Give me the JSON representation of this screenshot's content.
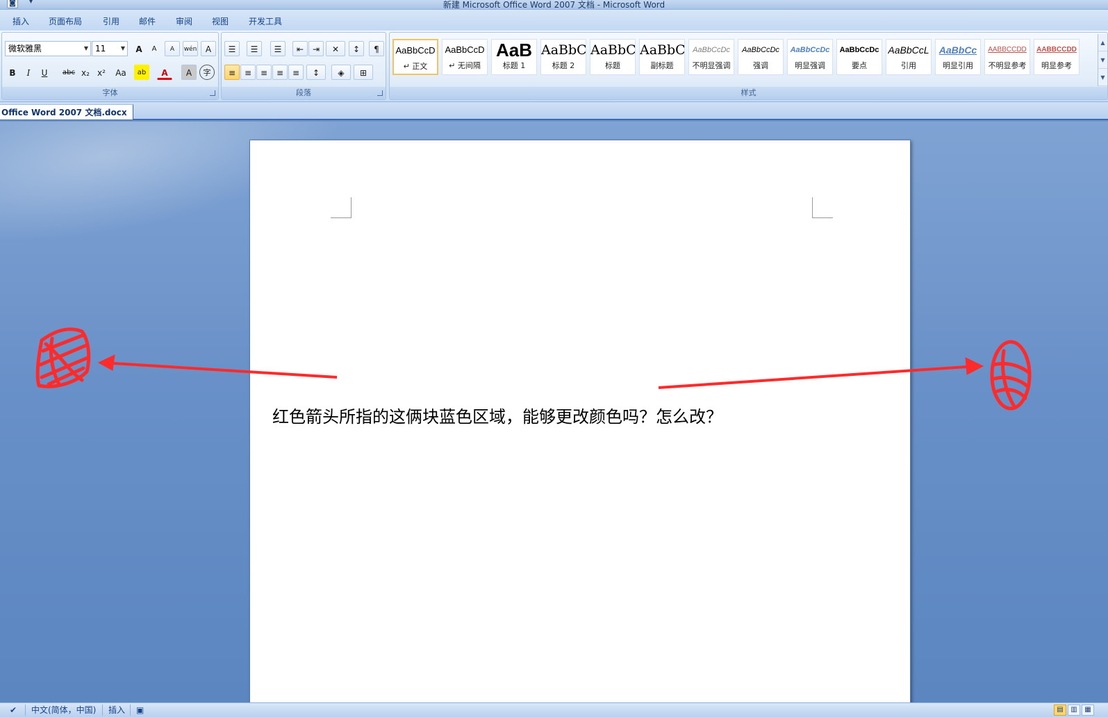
{
  "window": {
    "title": "新建 Microsoft Office Word 2007 文档 - Microsoft Word",
    "office_button_icon": "office-icon",
    "qat_dropdown": "▾"
  },
  "tabs": [
    "插入",
    "页面布局",
    "引用",
    "邮件",
    "审阅",
    "视图",
    "开发工具"
  ],
  "ribbon": {
    "font_group": {
      "label": "字体",
      "font_name": "微软雅黑",
      "font_size": "11",
      "grow_font": "A",
      "shrink_font": "A",
      "clear_format": "A",
      "phonetic_guide": "wén",
      "char_border": "A",
      "bold": "B",
      "italic": "I",
      "underline": "U",
      "strikethrough": "abc",
      "subscript": "x₂",
      "superscript": "x²",
      "change_case": "Aa",
      "highlight": "ab",
      "font_color": "A",
      "char_shading": "A",
      "enclose_char": "字"
    },
    "paragraph_group": {
      "label": "段落"
    },
    "styles_group": {
      "label": "样式",
      "styles": [
        {
          "preview": "AaBbCcD",
          "name": "↵ 正文"
        },
        {
          "preview": "AaBbCcD",
          "name": "↵ 无间隔"
        },
        {
          "preview": "AaB",
          "name": "标题 1"
        },
        {
          "preview": "AaBbC",
          "name": "标题 2"
        },
        {
          "preview": "AaBbC",
          "name": "标题"
        },
        {
          "preview": "AaBbC",
          "name": "副标题"
        },
        {
          "preview": "AaBbCcDc",
          "name": "不明显强调"
        },
        {
          "preview": "AaBbCcDc",
          "name": "强调"
        },
        {
          "preview": "AaBbCcDc",
          "name": "明显强调"
        },
        {
          "preview": "AaBbCcDc",
          "name": "要点"
        },
        {
          "preview": "AaBbCcL",
          "name": "引用"
        },
        {
          "preview": "AaBbCc",
          "name": "明显引用"
        },
        {
          "preview": "AABBCCDD",
          "name": "不明显参考"
        },
        {
          "preview": "AABBCCDD",
          "name": "明显参考"
        }
      ]
    }
  },
  "document_tab": "Office Word 2007 文档.docx",
  "document": {
    "text": "红色箭头所指的这俩块蓝色区域，能够更改颜色吗？怎么改？"
  },
  "statusbar": {
    "language": "中文(简体，中国)",
    "mode": "插入"
  },
  "colors": {
    "annotation_red": "#ff2a2a",
    "workspace_blue": "#6990c8",
    "selected_style_border": "#f3c263"
  }
}
